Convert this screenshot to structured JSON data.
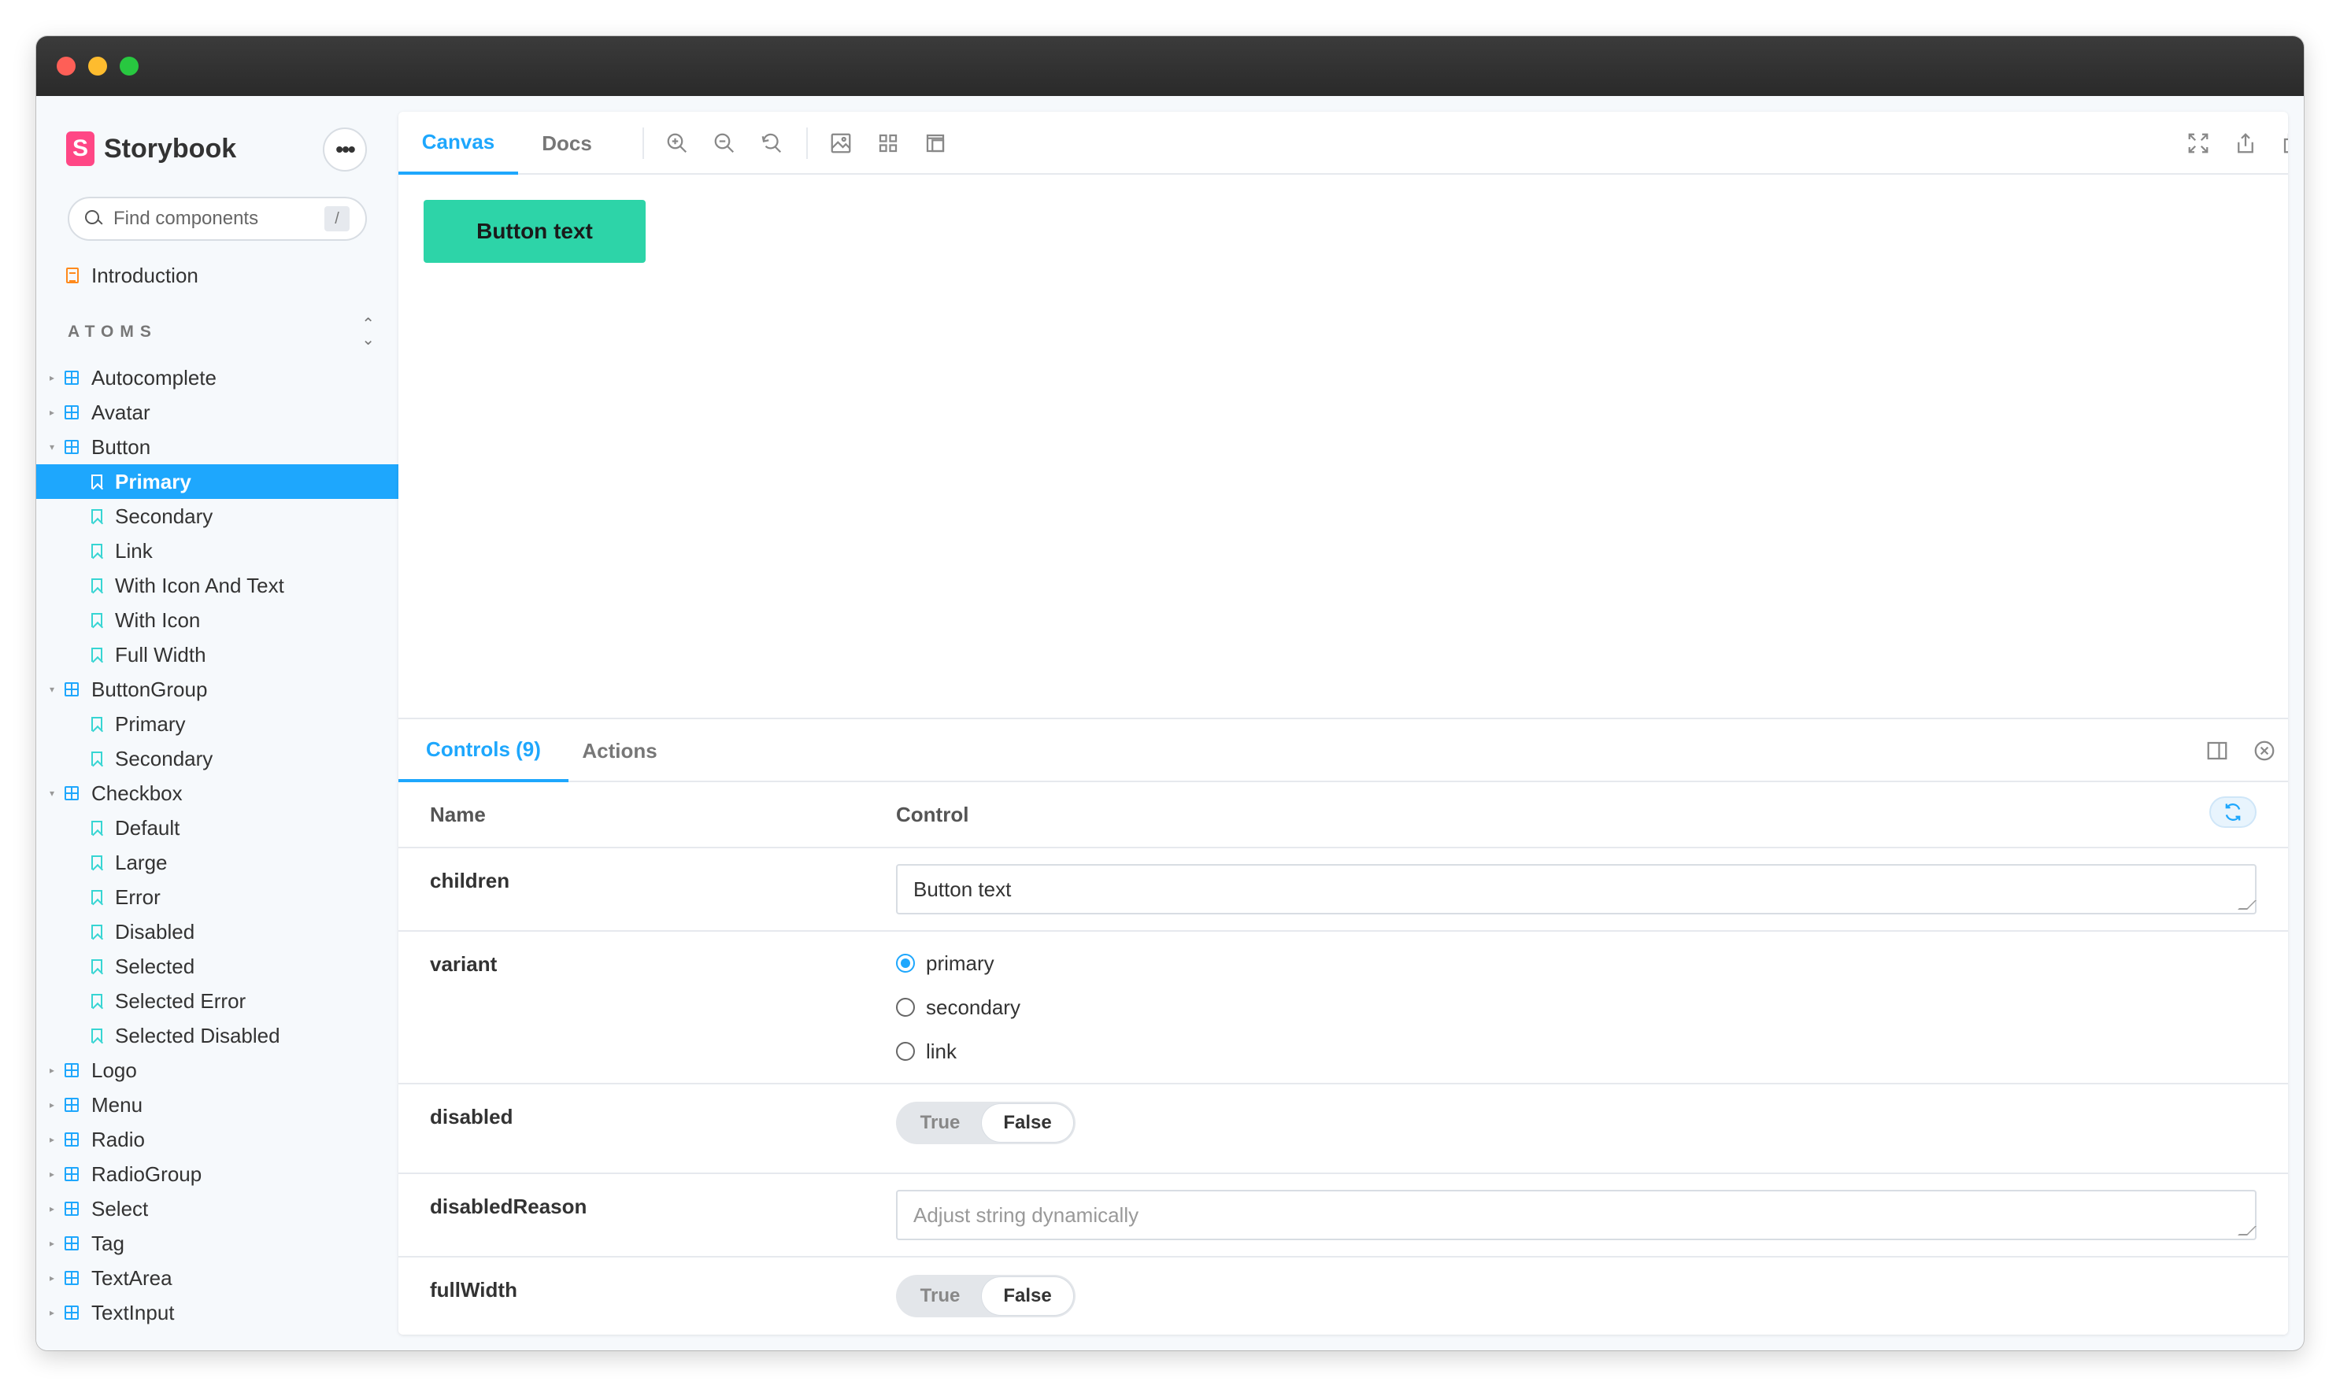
{
  "brand": {
    "name": "Storybook",
    "logo_letter": "S"
  },
  "search": {
    "placeholder": "Find components",
    "shortcut": "/"
  },
  "sidebar": {
    "intro_label": "Introduction",
    "section_title": "ATOMS",
    "tree": [
      {
        "label": "Autocomplete",
        "kind": "component",
        "expanded": false
      },
      {
        "label": "Avatar",
        "kind": "component",
        "expanded": false
      },
      {
        "label": "Button",
        "kind": "component",
        "expanded": true
      },
      {
        "label": "Primary",
        "kind": "story",
        "selected": true
      },
      {
        "label": "Secondary",
        "kind": "story"
      },
      {
        "label": "Link",
        "kind": "story"
      },
      {
        "label": "With Icon And Text",
        "kind": "story"
      },
      {
        "label": "With Icon",
        "kind": "story"
      },
      {
        "label": "Full Width",
        "kind": "story"
      },
      {
        "label": "ButtonGroup",
        "kind": "component",
        "expanded": true
      },
      {
        "label": "Primary",
        "kind": "story"
      },
      {
        "label": "Secondary",
        "kind": "story"
      },
      {
        "label": "Checkbox",
        "kind": "component",
        "expanded": true
      },
      {
        "label": "Default",
        "kind": "story"
      },
      {
        "label": "Large",
        "kind": "story"
      },
      {
        "label": "Error",
        "kind": "story"
      },
      {
        "label": "Disabled",
        "kind": "story"
      },
      {
        "label": "Selected",
        "kind": "story"
      },
      {
        "label": "Selected Error",
        "kind": "story"
      },
      {
        "label": "Selected Disabled",
        "kind": "story"
      },
      {
        "label": "Logo",
        "kind": "component",
        "expanded": false
      },
      {
        "label": "Menu",
        "kind": "component",
        "expanded": false
      },
      {
        "label": "Radio",
        "kind": "component",
        "expanded": false
      },
      {
        "label": "RadioGroup",
        "kind": "component",
        "expanded": false
      },
      {
        "label": "Select",
        "kind": "component",
        "expanded": false
      },
      {
        "label": "Tag",
        "kind": "component",
        "expanded": false
      },
      {
        "label": "TextArea",
        "kind": "component",
        "expanded": false
      },
      {
        "label": "TextInput",
        "kind": "component",
        "expanded": false
      }
    ]
  },
  "toolbar": {
    "tabs": [
      {
        "label": "Canvas",
        "active": true
      },
      {
        "label": "Docs",
        "active": false
      }
    ],
    "left_icons": [
      "zoom-in-icon",
      "zoom-out-icon",
      "zoom-reset-icon",
      "background-icon",
      "grid-icon",
      "measure-icon"
    ],
    "right_icons": [
      "fullscreen-icon",
      "share-icon",
      "copy-link-icon"
    ]
  },
  "canvas": {
    "preview_button_label": "Button text",
    "preview_button_color": "#2dd4a8"
  },
  "addons": {
    "tabs": [
      {
        "label": "Controls (9)",
        "active": true
      },
      {
        "label": "Actions",
        "active": false
      }
    ],
    "icons": [
      "panel-orientation-icon",
      "close-icon"
    ]
  },
  "controls": {
    "headers": {
      "name": "Name",
      "control": "Control"
    },
    "rows": {
      "children": {
        "name": "children",
        "value": "Button text"
      },
      "variant": {
        "name": "variant",
        "options": [
          "primary",
          "secondary",
          "link"
        ],
        "selected": "primary"
      },
      "disabled": {
        "name": "disabled",
        "true_label": "True",
        "false_label": "False",
        "value": false
      },
      "disabledReason": {
        "name": "disabledReason",
        "placeholder": "Adjust string dynamically"
      },
      "fullWidth": {
        "name": "fullWidth",
        "true_label": "True",
        "false_label": "False",
        "value": false
      }
    }
  },
  "colors": {
    "accent": "#1ea7fd",
    "brand": "#ff4785",
    "story_icon": "#37d5d3",
    "intro_icon": "#ff8a1c"
  }
}
